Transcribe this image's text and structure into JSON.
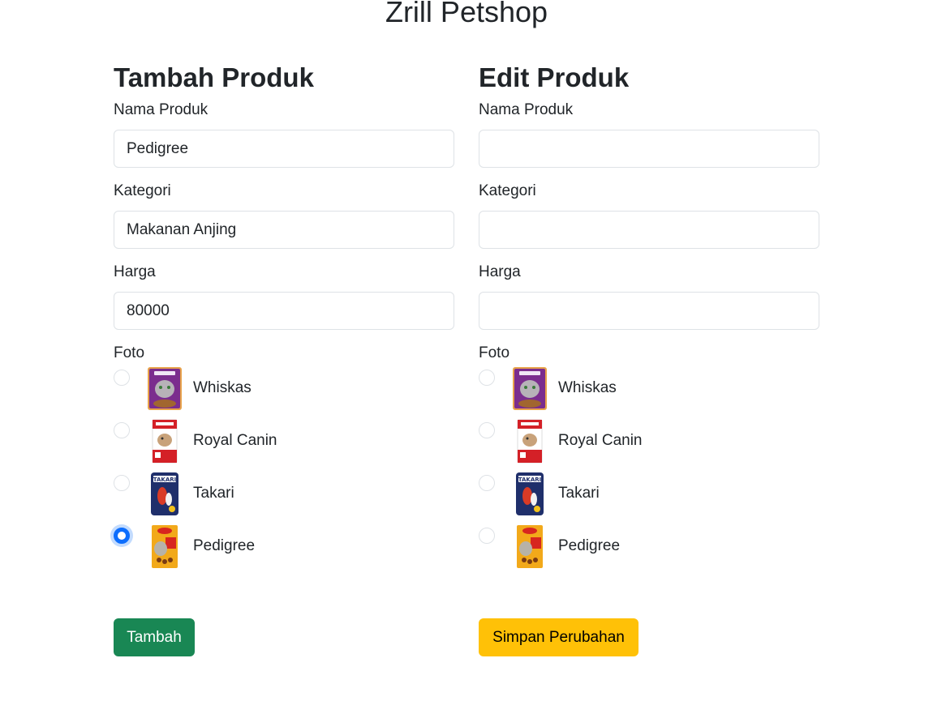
{
  "app": {
    "title": "Zrill Petshop"
  },
  "add_form": {
    "title": "Tambah Produk",
    "fields": [
      {
        "label": "Nama Produk",
        "value": "Pedigree"
      },
      {
        "label": "Kategori",
        "value": "Makanan Anjing"
      },
      {
        "label": "Harga",
        "value": "80000"
      }
    ],
    "foto_label": "Foto",
    "options": [
      {
        "label": "Whiskas",
        "icon": "whiskas-pouch-icon",
        "selected": false
      },
      {
        "label": "Royal Canin",
        "icon": "royal-canin-bag-icon",
        "selected": false
      },
      {
        "label": "Takari",
        "icon": "takari-pack-icon",
        "selected": false
      },
      {
        "label": "Pedigree",
        "icon": "pedigree-bag-icon",
        "selected": true
      }
    ],
    "submit_label": "Tambah"
  },
  "edit_form": {
    "title": "Edit Produk",
    "fields": [
      {
        "label": "Nama Produk",
        "value": ""
      },
      {
        "label": "Kategori",
        "value": ""
      },
      {
        "label": "Harga",
        "value": ""
      }
    ],
    "foto_label": "Foto",
    "options": [
      {
        "label": "Whiskas",
        "icon": "whiskas-pouch-icon",
        "selected": false
      },
      {
        "label": "Royal Canin",
        "icon": "royal-canin-bag-icon",
        "selected": false
      },
      {
        "label": "Takari",
        "icon": "takari-pack-icon",
        "selected": false
      },
      {
        "label": "Pedigree",
        "icon": "pedigree-bag-icon",
        "selected": false
      }
    ],
    "submit_label": "Simpan Perubahan"
  },
  "colors": {
    "primary": "#0d6efd",
    "success": "#198754",
    "warning": "#ffc107",
    "text": "#212529",
    "border": "#dee2e6"
  }
}
